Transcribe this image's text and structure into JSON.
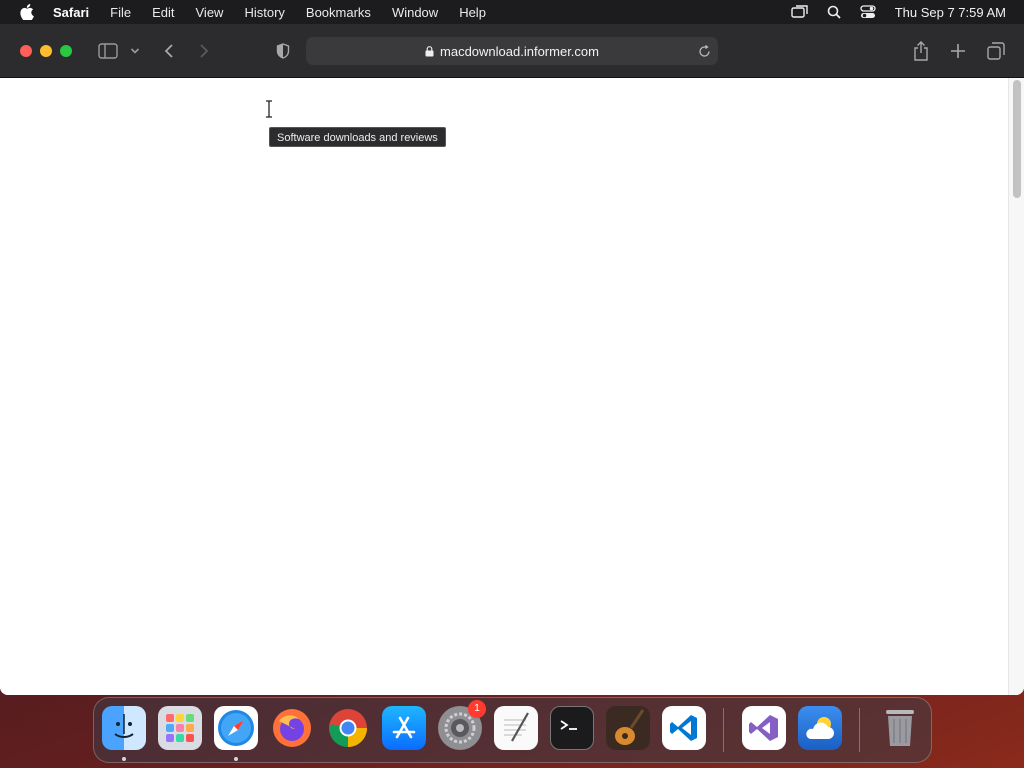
{
  "menubar": {
    "app_name": "Safari",
    "items": [
      "File",
      "Edit",
      "View",
      "History",
      "Bookmarks",
      "Window",
      "Help"
    ],
    "clock": "Thu Sep 7  7:59 AM"
  },
  "browser": {
    "url": "macdownload.informer.com"
  },
  "page": {
    "tooltip": "Software downloads and reviews"
  },
  "dock": {
    "apps": [
      {
        "name": "Finder",
        "icon": "finder-icon",
        "running": true
      },
      {
        "name": "Launchpad",
        "icon": "launchpad-icon",
        "running": false
      },
      {
        "name": "Safari",
        "icon": "safari-icon",
        "running": true
      },
      {
        "name": "Firefox",
        "icon": "firefox-icon",
        "running": false
      },
      {
        "name": "Chrome",
        "icon": "chrome-icon",
        "running": false
      },
      {
        "name": "App Store",
        "icon": "app-store-icon",
        "running": false
      },
      {
        "name": "System Settings",
        "icon": "system-settings-icon",
        "running": false,
        "badge": "1"
      },
      {
        "name": "TextEdit",
        "icon": "textedit-icon",
        "running": false
      },
      {
        "name": "Terminal",
        "icon": "terminal-icon",
        "running": false
      },
      {
        "name": "GarageBand",
        "icon": "garageband-icon",
        "running": false
      },
      {
        "name": "VS Code",
        "icon": "vscode-icon",
        "running": false
      },
      {
        "name": "Visual Studio",
        "icon": "visual-studio-icon",
        "running": false
      },
      {
        "name": "Weather",
        "icon": "weather-icon",
        "running": false
      },
      {
        "name": "Trash",
        "icon": "trash-icon",
        "running": false
      }
    ]
  },
  "colors": {
    "toolbar": "#2c2c2e",
    "menubar": "#1c1c1e",
    "close": "#ff5f57",
    "minimize": "#febc2e",
    "zoom": "#28c840",
    "badge": "#ff3b30"
  }
}
